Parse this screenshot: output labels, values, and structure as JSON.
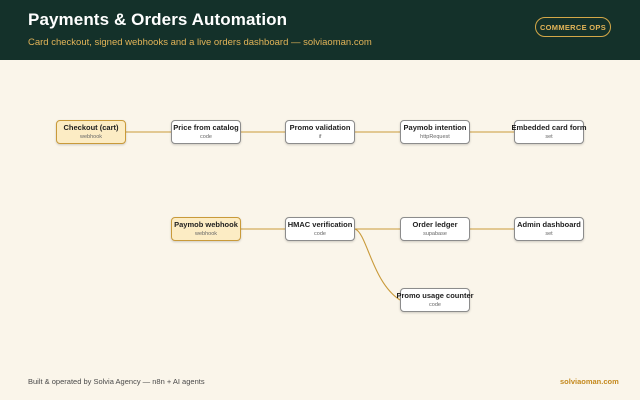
{
  "header": {
    "title": "Payments & Orders Automation",
    "subtitle": "Card checkout, signed webhooks and a live orders dashboard — solviaoman.com",
    "badge": "COMMERCE OPS"
  },
  "diagram": {
    "nodes": [
      {
        "id": "checkout",
        "label": "Checkout (cart)",
        "sub": "webhook",
        "kind": "trigger"
      },
      {
        "id": "price",
        "label": "Price from catalog",
        "sub": "code",
        "kind": "step"
      },
      {
        "id": "promo",
        "label": "Promo validation",
        "sub": "if",
        "kind": "step"
      },
      {
        "id": "paymob",
        "label": "Paymob intention",
        "sub": "httpRequest",
        "kind": "step"
      },
      {
        "id": "embedded",
        "label": "Embedded card form",
        "sub": "set",
        "kind": "step"
      },
      {
        "id": "webhook",
        "label": "Paymob webhook",
        "sub": "webhook",
        "kind": "trigger"
      },
      {
        "id": "hmac",
        "label": "HMAC verification",
        "sub": "code",
        "kind": "step"
      },
      {
        "id": "ledger",
        "label": "Order ledger",
        "sub": "supabase",
        "kind": "step"
      },
      {
        "id": "admin",
        "label": "Admin dashboard",
        "sub": "set",
        "kind": "step"
      },
      {
        "id": "usage",
        "label": "Promo usage counter",
        "sub": "code",
        "kind": "step"
      }
    ],
    "edges": [
      [
        "checkout",
        "price"
      ],
      [
        "price",
        "promo"
      ],
      [
        "promo",
        "paymob"
      ],
      [
        "paymob",
        "embedded"
      ],
      [
        "webhook",
        "hmac"
      ],
      [
        "hmac",
        "ledger"
      ],
      [
        "ledger",
        "admin"
      ],
      [
        "hmac",
        "usage"
      ]
    ]
  },
  "footer": {
    "left": "Built & operated by Solvia Agency — n8n + AI agents",
    "right": "solviaoman.com"
  }
}
